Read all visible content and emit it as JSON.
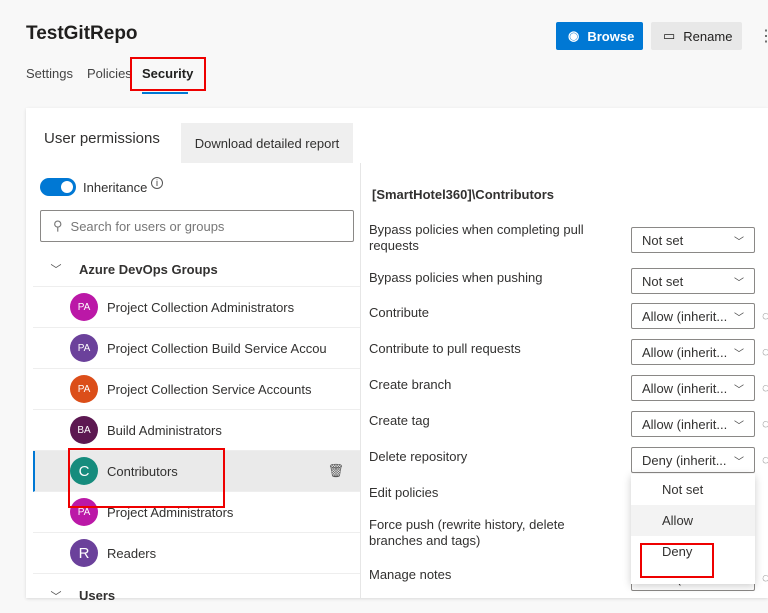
{
  "header": {
    "title": "TestGitRepo",
    "browse": "Browse",
    "rename": "Rename",
    "more": "⋮"
  },
  "tabs": [
    "Settings",
    "Policies",
    "Security"
  ],
  "panel": {
    "title": "User permissions",
    "download": "Download detailed report",
    "inheritance": "Inheritance",
    "search_placeholder": "Search for users or groups"
  },
  "groups": {
    "header": "Azure DevOps Groups",
    "users_header": "Users",
    "items": [
      {
        "initials": "PA",
        "name": "Project Collection Administrators",
        "color": "#b4009e"
      },
      {
        "initials": "PA",
        "name": "Project Collection Build Service Accou",
        "color": "#5c2d91"
      },
      {
        "initials": "PA",
        "name": "Project Collection Service Accounts",
        "color": "#d83b01"
      },
      {
        "initials": "BA",
        "name": "Build Administrators",
        "color": "#4b003f"
      },
      {
        "initials": "C",
        "name": "Contributors",
        "color": "#008272"
      },
      {
        "initials": "PA",
        "name": "Project Administrators",
        "color": "#b4009e"
      },
      {
        "initials": "R",
        "name": "Readers",
        "color": "#5c2d91"
      }
    ]
  },
  "permissions": {
    "title": "[SmartHotel360]\\Contributors",
    "items": [
      {
        "label": "Bypass policies when completing pull requests",
        "value": "Not set"
      },
      {
        "label": "Bypass policies when pushing",
        "value": "Not set"
      },
      {
        "label": "Contribute",
        "value": "Allow (inherit..."
      },
      {
        "label": "Contribute to pull requests",
        "value": "Allow (inherit..."
      },
      {
        "label": "Create branch",
        "value": "Allow (inherit..."
      },
      {
        "label": "Create tag",
        "value": "Allow (inherit..."
      },
      {
        "label": "Delete repository",
        "value": "Deny (inherit..."
      },
      {
        "label": "Edit policies",
        "value": ""
      },
      {
        "label": "Force push (rewrite history, delete branches and tags)",
        "value": ""
      },
      {
        "label": "Manage notes",
        "value": "Allow (inherit..."
      }
    ]
  },
  "menu": [
    "Not set",
    "Allow",
    "Deny"
  ]
}
